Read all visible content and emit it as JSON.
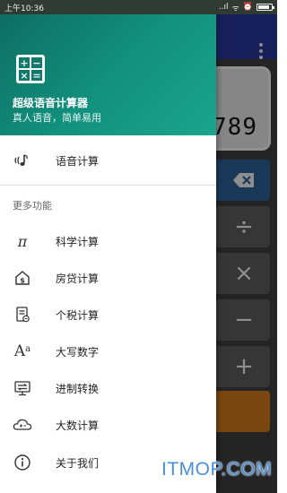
{
  "status_bar": {
    "time": "上午10:36",
    "signal": "..ıl",
    "wifi": "ᯤ",
    "alarm": "⏰"
  },
  "background_app": {
    "display_value": "789",
    "keys": {
      "backspace": "⌫",
      "divide": "÷",
      "multiply": "×",
      "minus": "−",
      "plus": "+"
    },
    "colors": {
      "appbar": "#283593",
      "key": "#575757",
      "backspace_key": "#2b5d8f",
      "equals_key": "#c7731b"
    }
  },
  "drawer": {
    "header": {
      "app_name": "超级语音计算器",
      "tagline": "真人语音，简单易用",
      "gradient_start": "#0d6b5f",
      "gradient_end": "#1ba48d"
    },
    "logo_glyphs": [
      "+",
      "−",
      "×",
      "="
    ],
    "primary_item": {
      "label": "语音计算",
      "icon": "voice-icon"
    },
    "section_title": "更多功能",
    "items": [
      {
        "label": "科学计算",
        "icon": "pi-icon"
      },
      {
        "label": "房贷计算",
        "icon": "house-dollar-icon"
      },
      {
        "label": "个税计算",
        "icon": "tax-document-icon"
      },
      {
        "label": "大写数字",
        "icon": "font-case-icon"
      },
      {
        "label": "进制转换",
        "icon": "base-convert-icon"
      },
      {
        "label": "大数计算",
        "icon": "cloud-calc-icon"
      },
      {
        "label": "关于我们",
        "icon": "info-icon"
      }
    ]
  },
  "watermark": "ITMOP.COM"
}
